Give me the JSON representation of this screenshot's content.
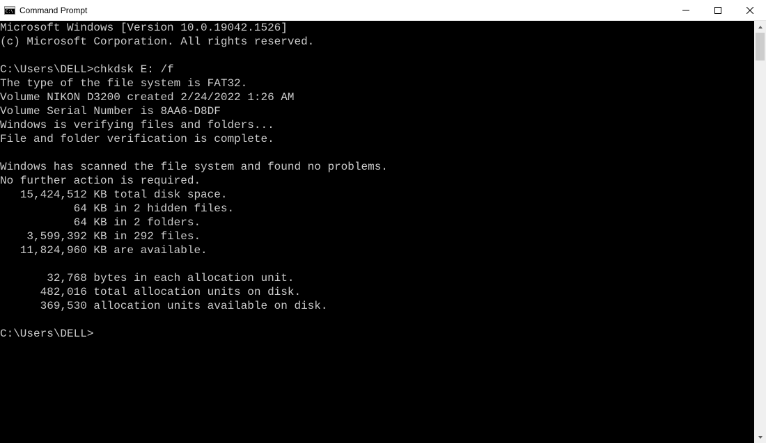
{
  "window": {
    "title": "Command Prompt"
  },
  "terminal": {
    "lines": [
      "Microsoft Windows [Version 10.0.19042.1526]",
      "(c) Microsoft Corporation. All rights reserved.",
      "",
      "C:\\Users\\DELL>chkdsk E: /f",
      "The type of the file system is FAT32.",
      "Volume NIKON D3200 created 2/24/2022 1:26 AM",
      "Volume Serial Number is 8AA6-D8DF",
      "Windows is verifying files and folders...",
      "File and folder verification is complete.",
      "",
      "Windows has scanned the file system and found no problems.",
      "No further action is required.",
      "   15,424,512 KB total disk space.",
      "           64 KB in 2 hidden files.",
      "           64 KB in 2 folders.",
      "    3,599,392 KB in 292 files.",
      "   11,824,960 KB are available.",
      "",
      "       32,768 bytes in each allocation unit.",
      "      482,016 total allocation units on disk.",
      "      369,530 allocation units available on disk.",
      "",
      "C:\\Users\\DELL>"
    ]
  }
}
